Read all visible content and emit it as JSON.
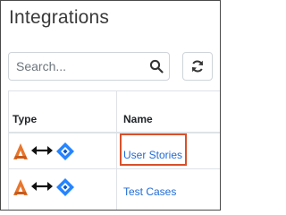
{
  "page": {
    "title": "Integrations"
  },
  "search": {
    "placeholder": "Search...",
    "value": ""
  },
  "table": {
    "columns": [
      "Type",
      "Name"
    ],
    "rows": [
      {
        "type_icons": [
          "source-logo-icon",
          "bidirectional-arrow-icon",
          "jira-icon"
        ],
        "name": "User Stories",
        "highlighted": true
      },
      {
        "type_icons": [
          "source-logo-icon",
          "bidirectional-arrow-icon",
          "jira-icon"
        ],
        "name": "Test Cases",
        "highlighted": false
      }
    ]
  },
  "colors": {
    "link": "#1f6bd6",
    "highlight": "#d9502a",
    "logo_orange": "#e8762d",
    "jira_blue": "#2684ff"
  }
}
